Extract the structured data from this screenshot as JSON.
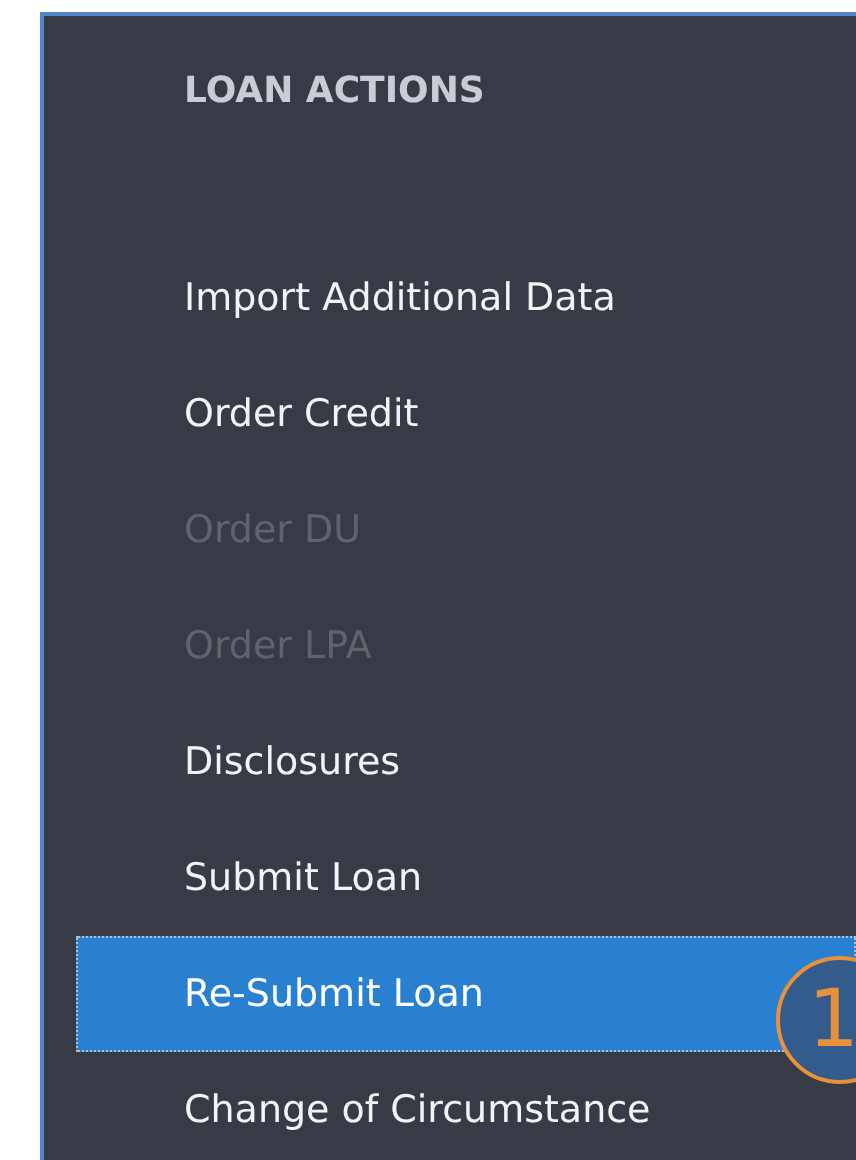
{
  "panel": {
    "title": "LOAN ACTIONS",
    "items": [
      {
        "label": "Import Additional Data",
        "disabled": false,
        "selected": false
      },
      {
        "label": "Order Credit",
        "disabled": false,
        "selected": false
      },
      {
        "label": "Order DU",
        "disabled": true,
        "selected": false
      },
      {
        "label": "Order LPA",
        "disabled": true,
        "selected": false
      },
      {
        "label": "Disclosures",
        "disabled": false,
        "selected": false
      },
      {
        "label": "Submit Loan",
        "disabled": false,
        "selected": false
      },
      {
        "label": "Re-Submit Loan",
        "disabled": false,
        "selected": true
      },
      {
        "label": "Change of Circumstance",
        "disabled": false,
        "selected": false
      }
    ]
  },
  "callout": {
    "label": "1"
  }
}
